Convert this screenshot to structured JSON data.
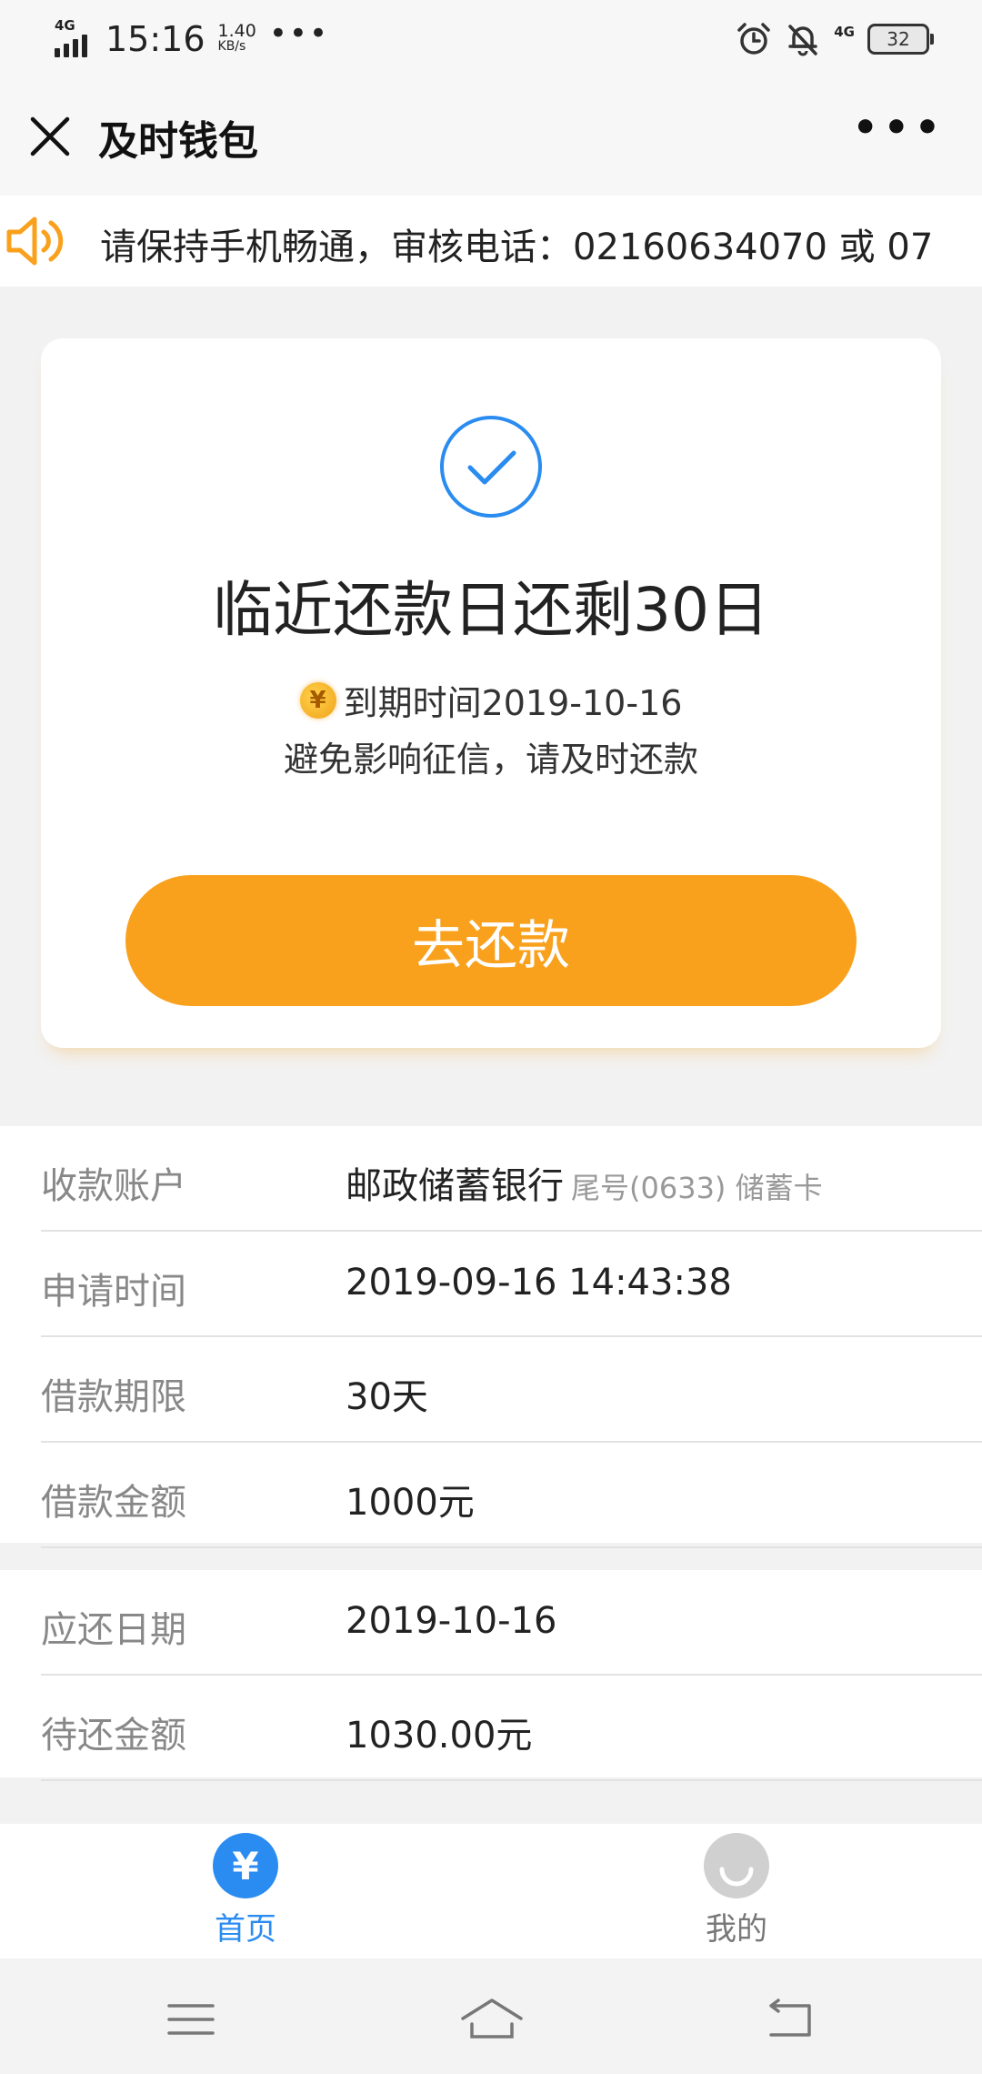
{
  "status_bar": {
    "network_left": "4G",
    "time": "15:16",
    "speed_value": "1.40",
    "speed_unit": "KB/s",
    "more": "•••",
    "network_right": "4G",
    "battery": "32"
  },
  "header": {
    "title": "及时钱包",
    "more": "•••"
  },
  "notice": {
    "text": "请保持手机畅通，审核电话：02160634070 或 07"
  },
  "card": {
    "title": "临近还款日还剩30日",
    "coin_symbol": "¥",
    "due_text": "到期时间2019-10-16",
    "tip": "避免影响征信，请及时还款",
    "button_label": "去还款",
    "accent_color": "#f9a11d"
  },
  "info": {
    "account": {
      "label": "收款账户",
      "bank": "邮政储蓄银行",
      "suffix": "尾号(0633) 储蓄卡"
    },
    "apply_time": {
      "label": "申请时间",
      "value": "2019-09-16 14:43:38"
    },
    "term": {
      "label": "借款期限",
      "value": "30天"
    },
    "amount": {
      "label": "借款金额",
      "value": "1000元"
    },
    "due_date": {
      "label": "应还日期",
      "value": "2019-10-16"
    },
    "pending": {
      "label": "待还金额",
      "value": "1030.00元"
    }
  },
  "tabs": {
    "home": {
      "label": "首页",
      "icon": "yen-icon",
      "symbol": "¥",
      "active_color": "#2a8cf0"
    },
    "mine": {
      "label": "我的",
      "icon": "smiley-icon"
    }
  }
}
